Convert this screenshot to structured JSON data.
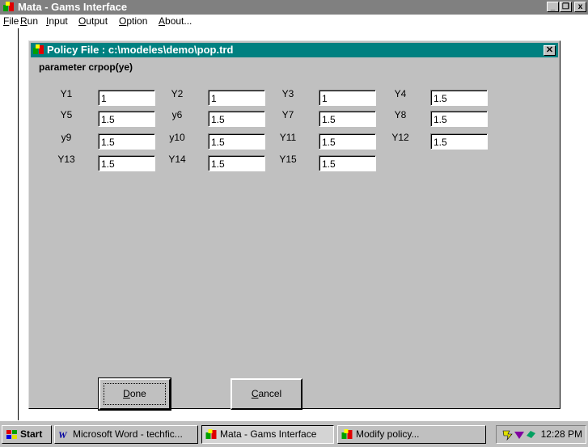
{
  "window": {
    "title": "Mata - Gams Interface",
    "min_glyph": "_",
    "max_glyph": "❐",
    "close_glyph": "x"
  },
  "menu": [
    {
      "label_u": "F",
      "label_rest": "ile"
    },
    {
      "label_u": "R",
      "label_rest": "un"
    },
    {
      "label_u": "I",
      "label_rest": "nput"
    },
    {
      "label_u": "O",
      "label_rest": "utput"
    },
    {
      "label_u": "O",
      "label_rest": "ption"
    },
    {
      "label_u": "A",
      "label_rest": "bout..."
    }
  ],
  "dialog": {
    "title": "Policy File : c:\\modeles\\demo\\pop.trd",
    "close_glyph": "✕",
    "heading": "parameter crpop(ye)",
    "fields": [
      {
        "label": "Y1",
        "value": "1"
      },
      {
        "label": "Y2",
        "value": "1"
      },
      {
        "label": "Y3",
        "value": "1"
      },
      {
        "label": "Y4",
        "value": "1.5"
      },
      {
        "label": "Y5",
        "value": "1.5"
      },
      {
        "label": "y6",
        "value": "1.5"
      },
      {
        "label": "Y7",
        "value": "1.5"
      },
      {
        "label": "Y8",
        "value": "1.5"
      },
      {
        "label": "y9",
        "value": "1.5"
      },
      {
        "label": "y10",
        "value": "1.5"
      },
      {
        "label": "Y11",
        "value": "1.5"
      },
      {
        "label": "Y12",
        "value": "1.5"
      },
      {
        "label": "Y13",
        "value": "1.5"
      },
      {
        "label": "Y14",
        "value": "1.5"
      },
      {
        "label": "Y15",
        "value": "1.5"
      }
    ],
    "done": {
      "u": "D",
      "rest": "one"
    },
    "cancel": {
      "u": "C",
      "rest": "ancel"
    }
  },
  "taskbar": {
    "start": "Start",
    "tasks": [
      {
        "label": "Microsoft Word - techfic..."
      },
      {
        "label": "Mata - Gams Interface"
      },
      {
        "label": "Modify policy..."
      }
    ],
    "clock": "12:28 PM"
  },
  "colors": {
    "dialog_title_bg": "#008080",
    "window_title_bg": "#808080",
    "face": "#c0c0c0"
  }
}
